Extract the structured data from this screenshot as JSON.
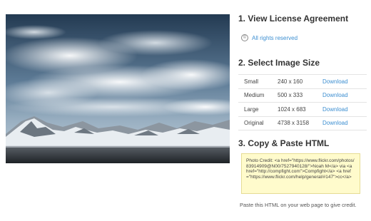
{
  "photo": {
    "alt": "Snowy mountains under a cloudy sky"
  },
  "license": {
    "heading": "1. View License Agreement",
    "icon": "copyright-icon",
    "text": "All rights reserved"
  },
  "size": {
    "heading": "2. Select Image Size",
    "rows": [
      {
        "name": "Small",
        "dims": "240 x 160",
        "action": "Download"
      },
      {
        "name": "Medium",
        "dims": "500 x 333",
        "action": "Download"
      },
      {
        "name": "Large",
        "dims": "1024 x 683",
        "action": "Download"
      },
      {
        "name": "Original",
        "dims": "4738 x 3158",
        "action": "Download"
      }
    ]
  },
  "copy": {
    "heading": "3. Copy & Paste HTML",
    "code": "Photo Credit: <a href=\"https://www.flickr.com/photos/83914909@N00/7527940128/\">Noah M</a> via <a href=\"http://compfight.com\">Compfight</a> <a href=\"https://www.flickr.com/help/general/#147\">cc</a>",
    "hint": "Paste this HTML on your web page to give credit."
  },
  "colors": {
    "link": "#3d8fd1",
    "code_bg": "#fffbcc"
  }
}
